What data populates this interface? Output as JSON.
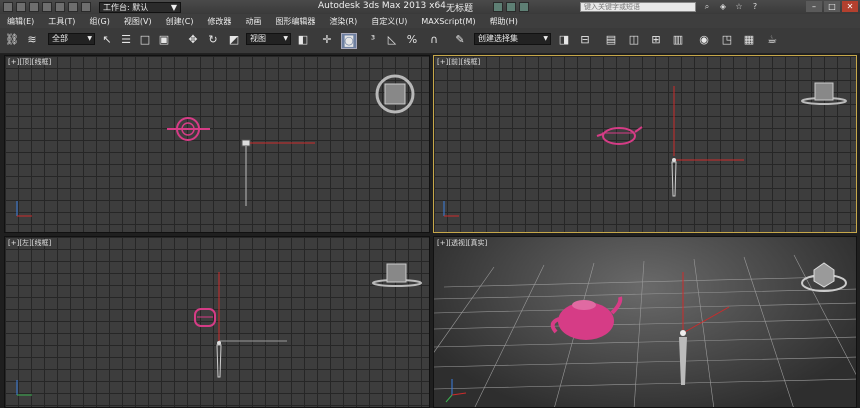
{
  "title_bar": {
    "workspace_label": "工作台: 默认",
    "app_title": "Autodesk 3ds Max  2013 x64",
    "doc_title": "无标题",
    "search_placeholder": "键入关键字或短语"
  },
  "menu": [
    "编辑(E)",
    "工具(T)",
    "组(G)",
    "视图(V)",
    "创建(C)",
    "修改器",
    "动画",
    "图形编辑器",
    "渲染(R)",
    "自定义(U)",
    "MAXScript(M)",
    "帮助(H)"
  ],
  "toolbar": {
    "selection_filter": "全部",
    "reference_coord": "视图",
    "named_selection": "创建选择集"
  },
  "viewports": {
    "top": {
      "label": "[+][顶][线框]"
    },
    "front": {
      "label": "[+][前][线框]"
    },
    "left": {
      "label": "[+][左][线框]"
    },
    "perspective": {
      "label": "[+][透视][真实]"
    }
  },
  "colors": {
    "teapot": "#d63c86",
    "axis_red": "#cc2b2b",
    "active_border": "#c7a84a"
  }
}
